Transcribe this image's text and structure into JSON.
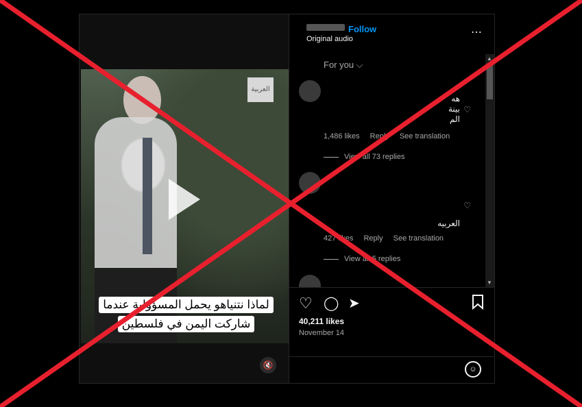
{
  "header": {
    "follow_label": "Follow",
    "audio_label": "Original audio",
    "more_icon": "⋯"
  },
  "video": {
    "logo_text": "العربية",
    "caption_lines": [
      "لماذا نتنياهو يحمل المسؤولية عندما",
      "شاركت اليمن في فلسطين"
    ],
    "mute_icon": "🔇"
  },
  "comments": {
    "sort_label": "For you ⌵",
    "items": [
      {
        "text": "هه\nبينة\nالم",
        "likes": "1,486 likes",
        "reply": "Reply",
        "translate": "See translation",
        "view_replies": "View all 73 replies"
      },
      {
        "text": "العربيه",
        "likes": "427 likes",
        "reply": "Reply",
        "translate": "See translation",
        "view_replies": "View all 5 replies"
      }
    ]
  },
  "actions": {
    "likes": "40,211 likes",
    "date": "November 14",
    "heart_icon": "♡",
    "comment_icon": "◯",
    "share_icon": "➤",
    "save_icon": "🔖",
    "emoji_icon": "☺"
  },
  "overlay": {
    "color": "#e8202e"
  }
}
